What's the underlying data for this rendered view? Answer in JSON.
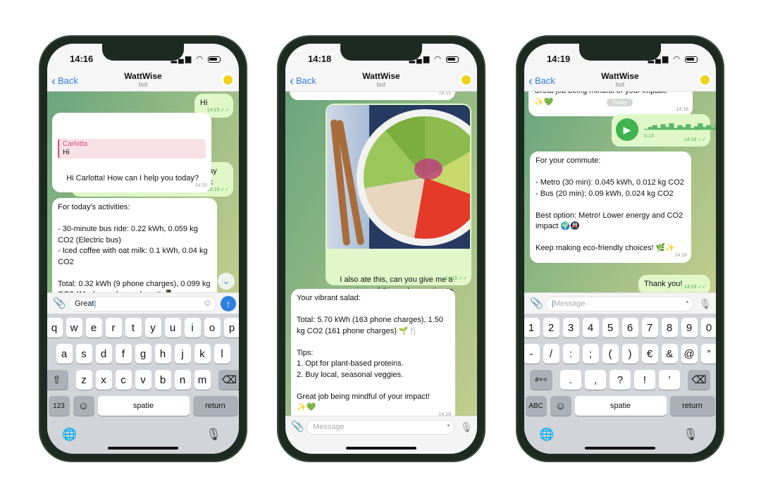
{
  "colors": {
    "accent": "#2f7fe0",
    "outgoing_bubble": "#e0f8c9",
    "incoming_bubble": "#ffffff",
    "send_button": "#2f7fe0",
    "voice_play": "#3fb34f"
  },
  "common": {
    "back_label": "Back",
    "chat_title": "WattWise",
    "chat_subtitle": "bot",
    "message_placeholder": "Message",
    "icons": {
      "back": "chevron-left-icon",
      "attach": "paperclip-icon",
      "emoji": "smiley-icon",
      "sticker": "sticker-icon",
      "mic": "microphone-icon",
      "send": "arrow-up-icon",
      "globe": "globe-icon",
      "scroll": "chevron-down-icon"
    }
  },
  "phones": [
    {
      "time": "14:16",
      "messages": [
        {
          "text": "Hi",
          "time": "14:15",
          "ticks": "✓✓"
        },
        {
          "quote_name": "Carlotta",
          "quote_text": "Hi",
          "text": "Hi Carlotta! How can I help you today?",
          "time": "14:15"
        },
        {
          "text": "I took the bus today for 30 minutes today and then had an ice coffee with oat milk",
          "time": "14:15",
          "ticks": "✓✓"
        },
        {
          "text": "For today's activities:\n\n- 30-minute bus ride: 0.22 kWh, 0.059 kg CO2 (Electric bus)\n- Iced coffee with oat milk: 0.1 kWh, 0.04 kg CO2\n\nTotal: 0.32 kWh (9 phone charges), 0.099 kg CO2 (11 phone charges) 🚌☕📱"
        }
      ],
      "input_value": "Great",
      "keyboard": {
        "row1": [
          "q",
          "w",
          "e",
          "r",
          "t",
          "y",
          "u",
          "i",
          "o",
          "p"
        ],
        "row2": [
          "a",
          "s",
          "d",
          "f",
          "g",
          "h",
          "j",
          "k",
          "l"
        ],
        "row3": [
          "z",
          "x",
          "c",
          "v",
          "b",
          "n",
          "m"
        ],
        "mode_key": "123",
        "space": "spatie",
        "return": "return"
      }
    },
    {
      "time": "14:18",
      "top_partial_time": "14:15",
      "messages": [
        {
          "text": "I also ate this, can you give me a comparison of this and some tips to reduce my impact",
          "time": "14:16",
          "ticks": "✓✓"
        },
        {
          "text": "Your vibrant salad:\n\nTotal: 5.70 kWh (163 phone charges), 1.50 kg CO2 (161 phone charges) 🌱🍴\n\nTips:\n1. Opt for plant-based proteins.\n2. Buy local, seasonal veggies.\n\nGreat job being mindful of your impact!\n✨💚",
          "time": "14:18"
        }
      ]
    },
    {
      "time": "14:19",
      "top_partial": {
        "text": "Great job being mindful of your impact!\n✨💚",
        "time": "14:18"
      },
      "date_pill": "Today",
      "voice": {
        "duration": "0:13",
        "time": "14:18",
        "ticks": "✓✓"
      },
      "messages": [
        {
          "text": "For your commute:\n\n- Metro (30 min): 0.045 kWh, 0.012 kg CO2\n- Bus (20 min): 0.09 kWh, 0.024 kg CO2\n\nBest option: Metro! Lower energy and CO2 impact 🌍🚇\n\nKeep making eco-friendly choices! 🌿✨",
          "time": "14:18"
        },
        {
          "text": "Thank you!",
          "time": "14:19",
          "ticks": "✓✓"
        }
      ],
      "keyboard": {
        "row1": [
          "1",
          "2",
          "3",
          "4",
          "5",
          "6",
          "7",
          "8",
          "9",
          "0"
        ],
        "row2": [
          "-",
          "/",
          ":",
          ";",
          "(",
          ")",
          "€",
          "&",
          "@",
          "”"
        ],
        "row3": [
          ".",
          ",",
          "?",
          "!",
          "’"
        ],
        "shift_key": "#+=",
        "mode_key": "ABC",
        "space": "spatie",
        "return": "return"
      }
    }
  ]
}
